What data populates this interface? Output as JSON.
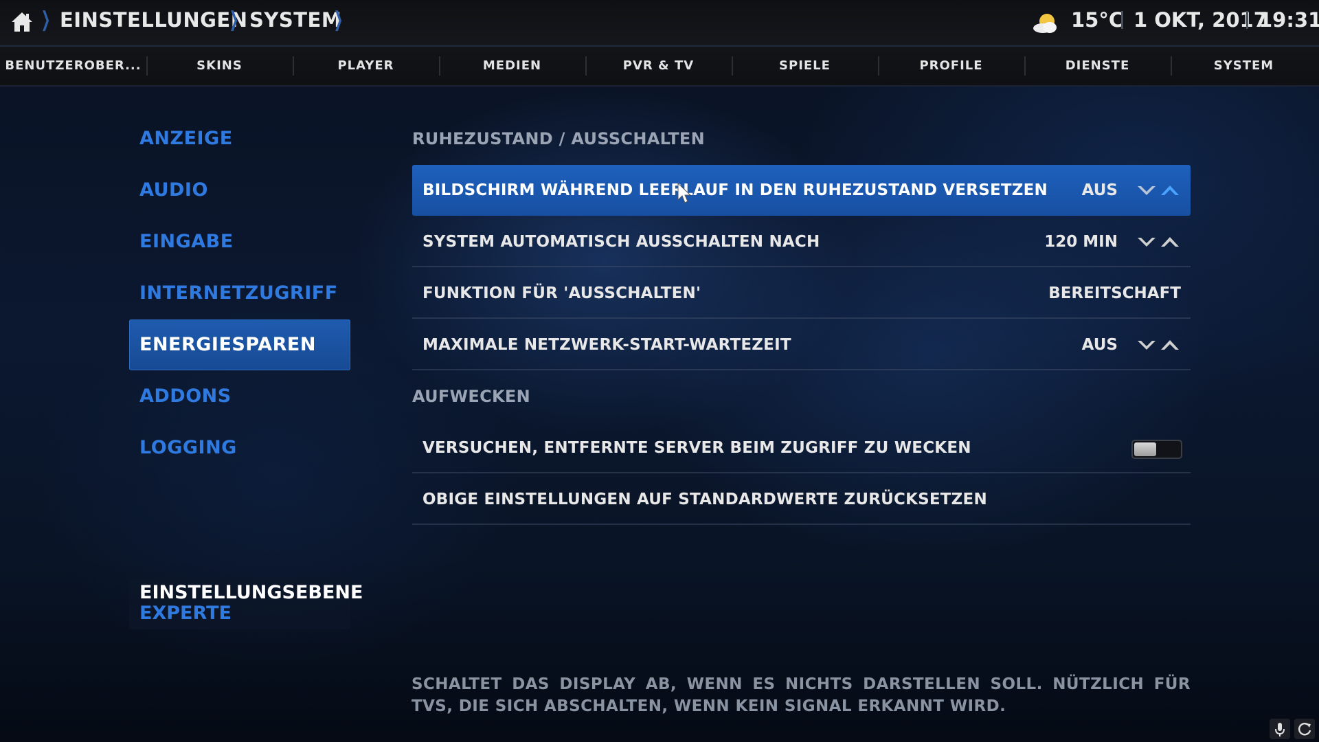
{
  "header": {
    "breadcrumb": [
      "EINSTELLUNGEN",
      "SYSTEM"
    ],
    "temperature": "15°C",
    "date": "1 OKT, 2017",
    "time": "19:31"
  },
  "tabs": [
    "BENUTZEROBER...",
    "SKINS",
    "PLAYER",
    "MEDIEN",
    "PVR & TV",
    "SPIELE",
    "PROFILE",
    "DIENSTE",
    "SYSTEM"
  ],
  "sidebar": {
    "items": [
      {
        "label": "ANZEIGE"
      },
      {
        "label": "AUDIO"
      },
      {
        "label": "EINGABE"
      },
      {
        "label": "INTERNETZUGRIFF"
      },
      {
        "label": "ENERGIESPAREN",
        "active": true
      },
      {
        "label": "ADDONS"
      },
      {
        "label": "LOGGING"
      }
    ],
    "level_title": "EINSTELLUNGSEBENE",
    "level_value": "EXPERTE"
  },
  "groups": [
    {
      "title": "RUHEZUSTAND / AUSSCHALTEN",
      "rows": [
        {
          "label": "BILDSCHIRM WÄHREND LEERLAUF IN DEN RUHEZUSTAND VERSETZEN",
          "value": "AUS",
          "control": "spinner",
          "focused": true
        },
        {
          "label": "SYSTEM AUTOMATISCH AUSSCHALTEN NACH",
          "value": "120 MIN",
          "control": "spinner"
        },
        {
          "label": "FUNKTION FÜR 'AUSSCHALTEN'",
          "value": "BEREITSCHAFT",
          "control": "list"
        },
        {
          "label": "MAXIMALE NETZWERK-START-WARTEZEIT",
          "value": "AUS",
          "control": "spinner"
        }
      ]
    },
    {
      "title": "AUFWECKEN",
      "rows": [
        {
          "label": "VERSUCHEN, ENTFERNTE SERVER BEIM ZUGRIFF ZU WECKEN",
          "control": "toggle",
          "toggle_on": false
        },
        {
          "label": "OBIGE EINSTELLUNGEN AUF STANDARDWERTE ZURÜCKSETZEN",
          "control": "action"
        }
      ]
    }
  ],
  "help_text": "SCHALTET DAS DISPLAY AB, WENN ES NICHTS DARSTELLEN SOLL. NÜTZLICH FÜR TVS, DIE SICH ABSCHALTEN, WENN KEIN SIGNAL ERKANNT WIRD.",
  "colors": {
    "accent": "#1e60bd",
    "sidebar_text": "#2f7ae0",
    "chevron": "#2f5fa8"
  },
  "icons": {
    "home": "home-icon",
    "weather": "partly-cloudy-icon",
    "corner": [
      "microphone-icon",
      "refresh-icon"
    ]
  }
}
